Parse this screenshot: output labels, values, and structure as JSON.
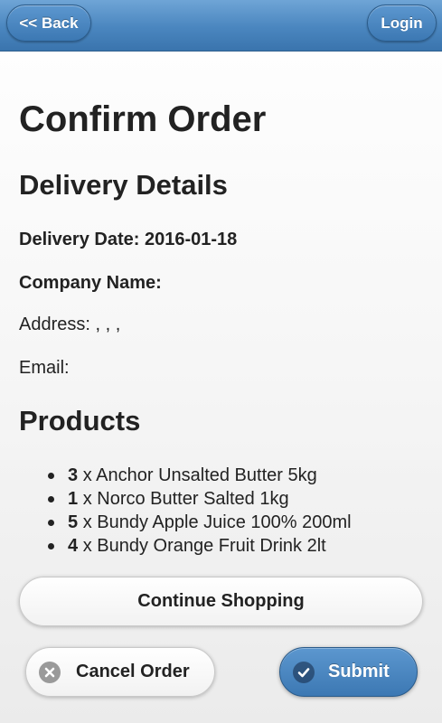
{
  "header": {
    "back_label": "<< Back",
    "login_label": "Login",
    "colors": {
      "bar": "#4a86bf",
      "button": "#3c78b3"
    }
  },
  "page": {
    "title": "Confirm Order"
  },
  "delivery": {
    "heading": "Delivery Details",
    "date_label": "Delivery Date:",
    "date_value": "2016-01-18",
    "company_label": "Company Name:",
    "company_value": "",
    "address_label": "Address:",
    "address_value": ", , ,",
    "email_label": "Email:",
    "email_value": ""
  },
  "products": {
    "heading": "Products",
    "separator": "x",
    "items": [
      {
        "qty": "3",
        "name": "Anchor Unsalted Butter 5kg"
      },
      {
        "qty": "1",
        "name": "Norco Butter Salted 1kg"
      },
      {
        "qty": "5",
        "name": "Bundy Apple Juice 100% 200ml"
      },
      {
        "qty": "4",
        "name": "Bundy Orange Fruit Drink 2lt"
      }
    ]
  },
  "actions": {
    "continue_label": "Continue Shopping",
    "cancel_label": "Cancel Order",
    "cancel_icon": "close-circle-icon",
    "submit_label": "Submit",
    "submit_icon": "check-circle-icon"
  }
}
